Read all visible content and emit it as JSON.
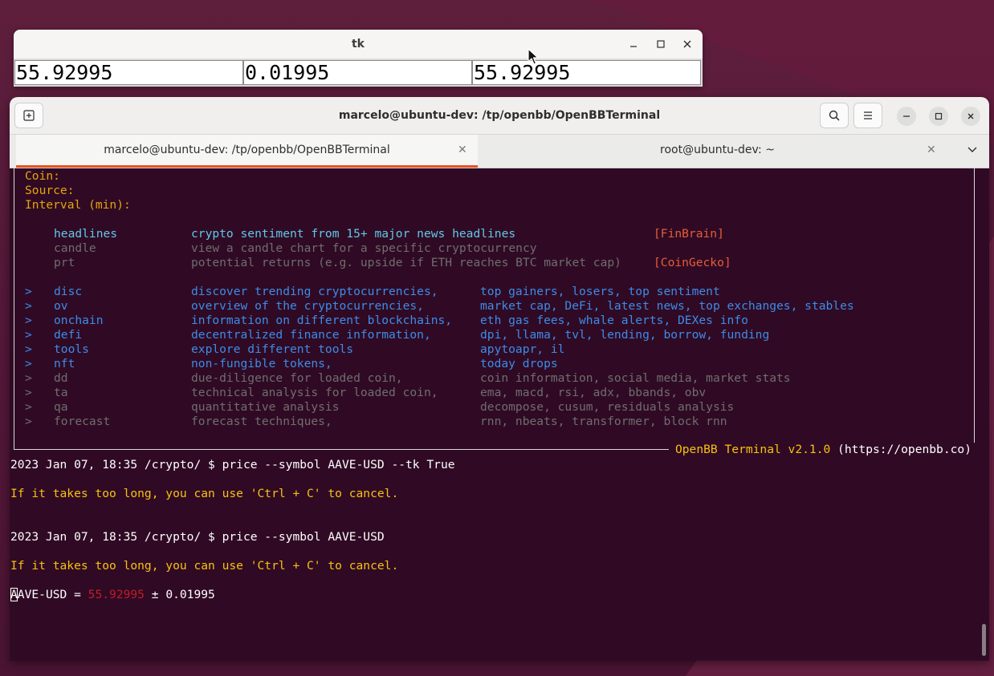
{
  "tk": {
    "title": "tk",
    "entries": [
      "55.92995",
      "0.01995",
      "55.92995"
    ]
  },
  "terminal": {
    "title": "marcelo@ubuntu-dev: /tp/openbb/OpenBBTerminal",
    "tabs": [
      {
        "label": "marcelo@ubuntu-dev: /tp/openbb/OpenBBTerminal"
      },
      {
        "label": "root@ubuntu-dev: ~"
      }
    ],
    "menu": {
      "coin_label": "Coin:",
      "source_label": "Source:",
      "interval_label": "Interval (min):",
      "commands": [
        {
          "cmd": "headlines",
          "desc": "crypto sentiment from 15+ major news headlines",
          "source": "[FinBrain]"
        },
        {
          "cmd": "candle",
          "desc": "view a candle chart for a specific cryptocurrency"
        },
        {
          "cmd": "prt",
          "desc": "potential returns (e.g. upside if ETH reaches BTC market cap)",
          "source": "[CoinGecko]"
        }
      ],
      "menus": [
        {
          "arrow": ">",
          "cmd": "disc",
          "desc": "discover trending cryptocurrencies,",
          "sub": "top gainers, losers, top sentiment"
        },
        {
          "arrow": ">",
          "cmd": "ov",
          "desc": "overview of the cryptocurrencies,",
          "sub": "market cap, DeFi, latest news, top exchanges, stables"
        },
        {
          "arrow": ">",
          "cmd": "onchain",
          "desc": "information on different blockchains,",
          "sub": "eth gas fees, whale alerts, DEXes info"
        },
        {
          "arrow": ">",
          "cmd": "defi",
          "desc": "decentralized finance information,",
          "sub": "dpi, llama, tvl, lending, borrow, funding"
        },
        {
          "arrow": ">",
          "cmd": "tools",
          "desc": "explore different tools",
          "sub": "apytoapr, il"
        },
        {
          "arrow": ">",
          "cmd": "nft",
          "desc": "non-fungible tokens,",
          "sub": "today drops"
        },
        {
          "arrow": ">",
          "cmd": "dd",
          "desc": "due-diligence for loaded coin,",
          "sub": "coin information, social media, market stats"
        },
        {
          "arrow": ">",
          "cmd": "ta",
          "desc": "technical analysis for loaded coin,",
          "sub": "ema, macd, rsi, adx, bbands, obv"
        },
        {
          "arrow": ">",
          "cmd": "qa",
          "desc": "quantitative analysis",
          "sub": "decompose, cusum, residuals analysis"
        },
        {
          "arrow": ">",
          "cmd": "forecast",
          "desc": "forecast techniques,",
          "sub": "rnn, nbeats, transformer, block rnn"
        }
      ],
      "footer_name": "OpenBB Terminal v2.1.0",
      "footer_url": " (https://openbb.co)"
    },
    "session": {
      "prompt1": "2023 Jan 07, 18:35 /crypto/ $ price --symbol AAVE-USD --tk True",
      "hint1": "If it takes too long, you can use 'Ctrl + C' to cancel.",
      "prompt2": "2023 Jan 07, 18:35 /crypto/ $ price --symbol AAVE-USD",
      "hint2": "If it takes too long, you can use 'Ctrl + C' to cancel.",
      "result_cursor_char": "A",
      "result_prefix": "AVE-USD = ",
      "result_price": "55.92995",
      "result_suffix": " ± 0.01995"
    }
  },
  "colors": {
    "terminal_bg": "#300a24",
    "accent_tab": "#e95420",
    "label_yellow": "#e5a50a",
    "command_cyan": "#60c8e8",
    "menu_blue": "#3c8ce8",
    "disabled_gray": "#6e6e6e",
    "source_orange": "#e65c38",
    "price_red": "#c01c28"
  }
}
